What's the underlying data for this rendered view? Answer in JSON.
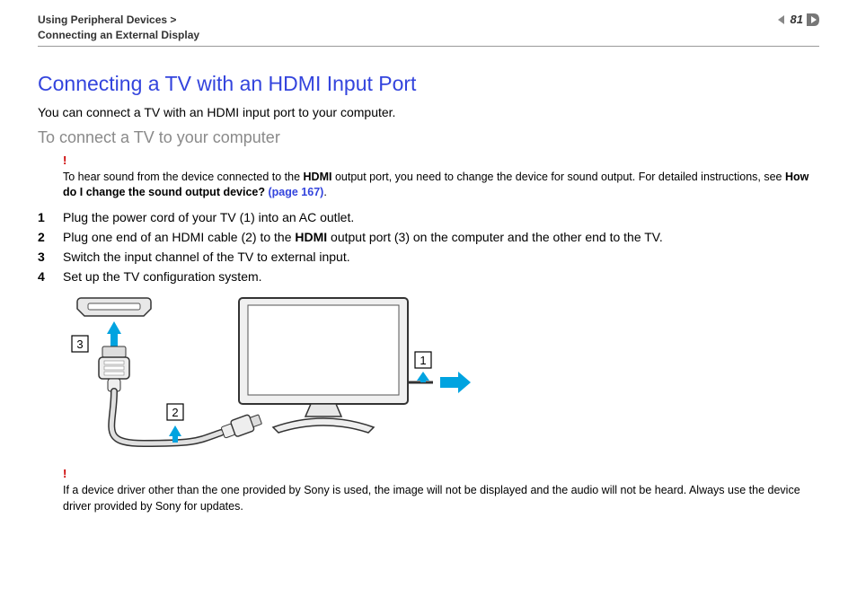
{
  "header": {
    "breadcrumb_section": "Using Peripheral Devices",
    "breadcrumb_sep": ">",
    "breadcrumb_page": "Connecting an External Display",
    "page_number": "81"
  },
  "title": "Connecting a TV with an HDMI Input Port",
  "intro": "You can connect a TV with an HDMI input port to your computer.",
  "subhead": "To connect a TV to your computer",
  "notice1": {
    "bang": "!",
    "pre": "To hear sound from the device connected to the ",
    "b1": "HDMI",
    "mid": " output port, you need to change the device for sound output. For detailed instructions, see ",
    "b2": "How do I change the sound output device? ",
    "link": "(page 167)",
    "post": "."
  },
  "steps": [
    {
      "n": "1",
      "pre": "Plug the power cord of your TV (1) into an AC outlet.",
      "b": "",
      "post": ""
    },
    {
      "n": "2",
      "pre": "Plug one end of an HDMI cable (2) to the ",
      "b": "HDMI",
      "post": " output port (3) on the computer and the other end to the TV."
    },
    {
      "n": "3",
      "pre": "Switch the input channel of the TV to external input.",
      "b": "",
      "post": ""
    },
    {
      "n": "4",
      "pre": "Set up the TV configuration system.",
      "b": "",
      "post": ""
    }
  ],
  "diagram": {
    "labels": {
      "l1": "1",
      "l2": "2",
      "l3": "3"
    }
  },
  "notice2": {
    "bang": "!",
    "text": "If a device driver other than the one provided by Sony is used, the image will not be displayed and the audio will not be heard. Always use the device driver provided by Sony for updates."
  }
}
